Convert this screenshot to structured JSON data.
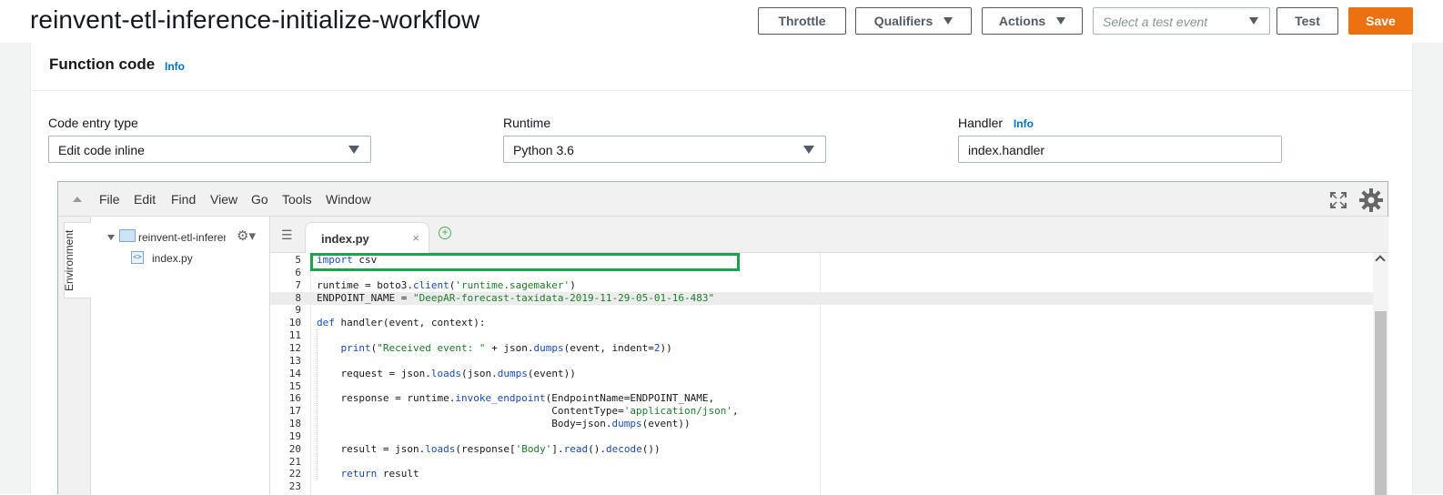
{
  "header": {
    "title": "reinvent-etl-inference-initialize-workflow",
    "throttle_label": "Throttle",
    "qualifiers_label": "Qualifiers",
    "actions_label": "Actions",
    "test_event_placeholder": "Select a test event",
    "test_label": "Test",
    "save_label": "Save"
  },
  "panel": {
    "title": "Function code",
    "info": "Info"
  },
  "fields": {
    "code_entry_label": "Code entry type",
    "code_entry_value": "Edit code inline",
    "runtime_label": "Runtime",
    "runtime_value": "Python 3.6",
    "handler_label": "Handler",
    "handler_info": "Info",
    "handler_value": "index.handler"
  },
  "ide": {
    "menu": [
      "File",
      "Edit",
      "Find",
      "View",
      "Go",
      "Tools",
      "Window"
    ],
    "environment_label": "Environment",
    "folder_name": "reinvent-etl-inference",
    "file_name": "index.py",
    "tab_label": "index.py",
    "tab_close": "×",
    "tab_add": "+"
  },
  "code": {
    "active_line": 8,
    "lines": [
      {
        "n": "5",
        "html": "<span class=\"kw\">import</span> csv"
      },
      {
        "n": "6",
        "html": ""
      },
      {
        "n": "7",
        "html": "runtime = boto3.<span class=\"fn\">client</span>(<span class=\"str\">'runtime.sagemaker'</span>)"
      },
      {
        "n": "8",
        "html": "ENDPOINT_NAME = <span class=\"str\">\"DeepAR-forecast-taxidata-2019-11-29-05-01-16-483\"</span>"
      },
      {
        "n": "9",
        "html": ""
      },
      {
        "n": "10",
        "html": "<span class=\"kw\">def</span> handler(event, context):"
      },
      {
        "n": "11",
        "html": ""
      },
      {
        "n": "12",
        "html": "    <span class=\"fn\">print</span>(<span class=\"str\">\"Received event: \"</span> + json.<span class=\"fn\">dumps</span>(event, indent=<span class=\"num\">2</span>))"
      },
      {
        "n": "13",
        "html": ""
      },
      {
        "n": "14",
        "html": "    request = json.<span class=\"fn\">loads</span>(json.<span class=\"fn\">dumps</span>(event))"
      },
      {
        "n": "15",
        "html": ""
      },
      {
        "n": "16",
        "html": "    response = runtime.<span class=\"fn\">invoke_endpoint</span>(EndpointName=ENDPOINT_NAME,"
      },
      {
        "n": "17",
        "html": "                                       ContentType=<span class=\"str\">'application/json'</span>,"
      },
      {
        "n": "18",
        "html": "                                       Body=json.<span class=\"fn\">dumps</span>(event))"
      },
      {
        "n": "19",
        "html": ""
      },
      {
        "n": "20",
        "html": "    result = json.<span class=\"fn\">loads</span>(response[<span class=\"str\">'Body'</span>].<span class=\"fn\">read</span>().<span class=\"fn\">decode</span>())"
      },
      {
        "n": "21",
        "html": ""
      },
      {
        "n": "22",
        "html": "    <span class=\"kw\">return</span> result"
      },
      {
        "n": "23",
        "html": ""
      }
    ]
  },
  "colors": {
    "save_orange": "#ec7211",
    "highlight_green": "#1fa34a",
    "link_blue": "#0073bb"
  }
}
